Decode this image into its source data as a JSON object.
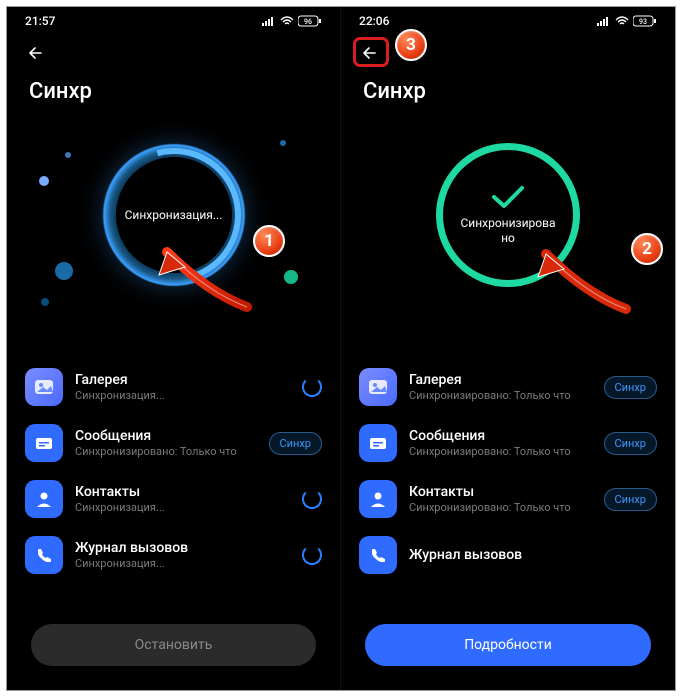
{
  "left": {
    "status": {
      "time": "21:57",
      "battery": "96"
    },
    "title": "Синхр",
    "hero_label": "Синхронизация...",
    "items": [
      {
        "name": "Галерея",
        "sub": "Синхронизация...",
        "right": "spinner"
      },
      {
        "name": "Сообщения",
        "sub": "Синхронизировано: Только что",
        "right": "chip"
      },
      {
        "name": "Контакты",
        "sub": "Синхронизация...",
        "right": "spinner"
      },
      {
        "name": "Журнал вызовов",
        "sub": "Синхронизация...",
        "right": "spinner"
      }
    ],
    "button": "Остановить"
  },
  "right": {
    "status": {
      "time": "22:06",
      "battery": "93"
    },
    "title": "Синхр",
    "hero_label": "Синхронизирова\nно",
    "items": [
      {
        "name": "Галерея",
        "sub": "Синхронизировано: Только что",
        "right": "chip"
      },
      {
        "name": "Сообщения",
        "sub": "Синхронизировано: Только что",
        "right": "chip"
      },
      {
        "name": "Контакты",
        "sub": "Синхронизировано: Только что",
        "right": "chip"
      },
      {
        "name": "Журнал вызовов",
        "sub": "",
        "right": "none"
      }
    ],
    "button": "Подробности"
  },
  "chip_label": "Синхр",
  "markers": {
    "m1": "1",
    "m2": "2",
    "m3": "3"
  }
}
